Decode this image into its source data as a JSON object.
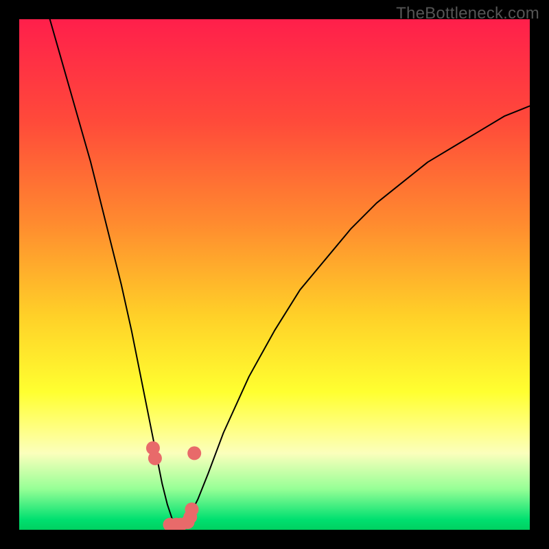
{
  "watermark": {
    "text": "TheBottleneck.com"
  },
  "chart_data": {
    "type": "line",
    "title": "",
    "xlabel": "",
    "ylabel": "",
    "xlim": [
      0,
      100
    ],
    "ylim": [
      0,
      100
    ],
    "series": [
      {
        "name": "curve",
        "x": [
          6,
          8,
          10,
          12,
          14,
          16,
          18,
          20,
          22,
          24,
          25,
          26,
          27,
          28,
          29,
          30,
          31,
          32,
          33,
          34,
          35,
          37,
          40,
          45,
          50,
          55,
          60,
          65,
          70,
          75,
          80,
          85,
          90,
          95,
          100
        ],
        "y": [
          100,
          93,
          86,
          79,
          72,
          64,
          56,
          48,
          39,
          29,
          24,
          19,
          14,
          9,
          5,
          2,
          1,
          1,
          2,
          4,
          6,
          11,
          19,
          30,
          39,
          47,
          53,
          59,
          64,
          68,
          72,
          75,
          78,
          81,
          83
        ]
      }
    ],
    "markers": {
      "name": "red-points",
      "x": [
        26.2,
        26.6,
        29.5,
        30.8,
        31.6,
        33.0,
        33.5,
        33.8,
        34.3
      ],
      "y": [
        16,
        14,
        1,
        1,
        1,
        1.5,
        2.5,
        4,
        15
      ]
    },
    "gradient_stops": [
      {
        "offset": 0,
        "color": "#ff1f4b"
      },
      {
        "offset": 20,
        "color": "#ff4a3a"
      },
      {
        "offset": 40,
        "color": "#ff8b2f"
      },
      {
        "offset": 58,
        "color": "#ffd028"
      },
      {
        "offset": 73,
        "color": "#ffff30"
      },
      {
        "offset": 80,
        "color": "#ffff80"
      },
      {
        "offset": 85,
        "color": "#fbffbc"
      },
      {
        "offset": 92,
        "color": "#96ff96"
      },
      {
        "offset": 98,
        "color": "#00e070"
      },
      {
        "offset": 100,
        "color": "#00d060"
      }
    ]
  }
}
